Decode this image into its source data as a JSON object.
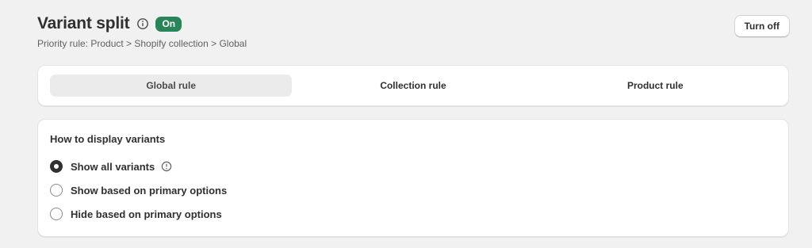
{
  "header": {
    "title": "Variant split",
    "status_badge": "On",
    "subtitle": "Priority rule: Product > Shopify collection > Global",
    "turn_off_label": "Turn off"
  },
  "tabs": [
    {
      "label": "Global rule",
      "active": true
    },
    {
      "label": "Collection rule",
      "active": false
    },
    {
      "label": "Product rule",
      "active": false
    }
  ],
  "display": {
    "section_title": "How to display variants",
    "options": [
      {
        "label": "Show all variants",
        "selected": true,
        "icon": "info-icon"
      },
      {
        "label": "Show based on primary options",
        "selected": false
      },
      {
        "label": "Hide based on primary options",
        "selected": false
      }
    ]
  },
  "colors": {
    "badge_green": "#29845a",
    "background": "#f1f1f1",
    "text": "#303030"
  }
}
